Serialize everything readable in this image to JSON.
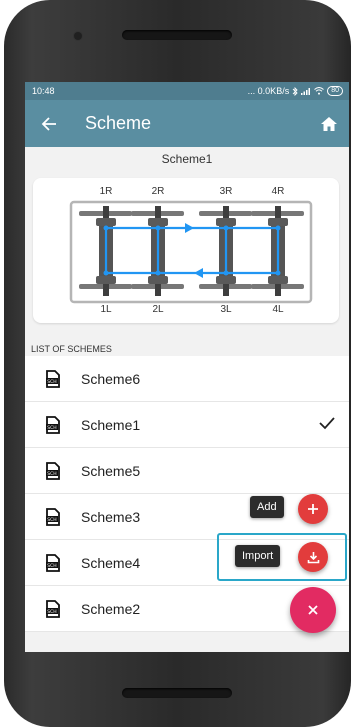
{
  "status_bar": {
    "time": "10:48",
    "network_speed": "... 0.0KB/s",
    "battery": "80"
  },
  "app_bar": {
    "title": "Scheme",
    "back_icon": "arrow-left-icon",
    "home_icon": "home-icon"
  },
  "current_scheme": "Scheme1",
  "diagram": {
    "top_labels": [
      "1R",
      "2R",
      "3R",
      "4R"
    ],
    "bottom_labels": [
      "1L",
      "2L",
      "3L",
      "4L"
    ],
    "path_color": "#2196f3"
  },
  "list": {
    "header": "LIST OF SCHEMES",
    "items": [
      {
        "label": "Scheme6",
        "selected": false
      },
      {
        "label": "Scheme1",
        "selected": true
      },
      {
        "label": "Scheme5",
        "selected": false
      },
      {
        "label": "Scheme3",
        "selected": false
      },
      {
        "label": "Scheme4",
        "selected": false
      },
      {
        "label": "Scheme2",
        "selected": false
      }
    ]
  },
  "fab": {
    "add_label": "Add",
    "import_label": "Import"
  },
  "colors": {
    "app_bar": "#5a8ea1",
    "status_bar": "#4f7d8f",
    "fab_mini": "#e23c3c",
    "fab_main": "#e22b62",
    "highlight": "#2aa7c9"
  }
}
